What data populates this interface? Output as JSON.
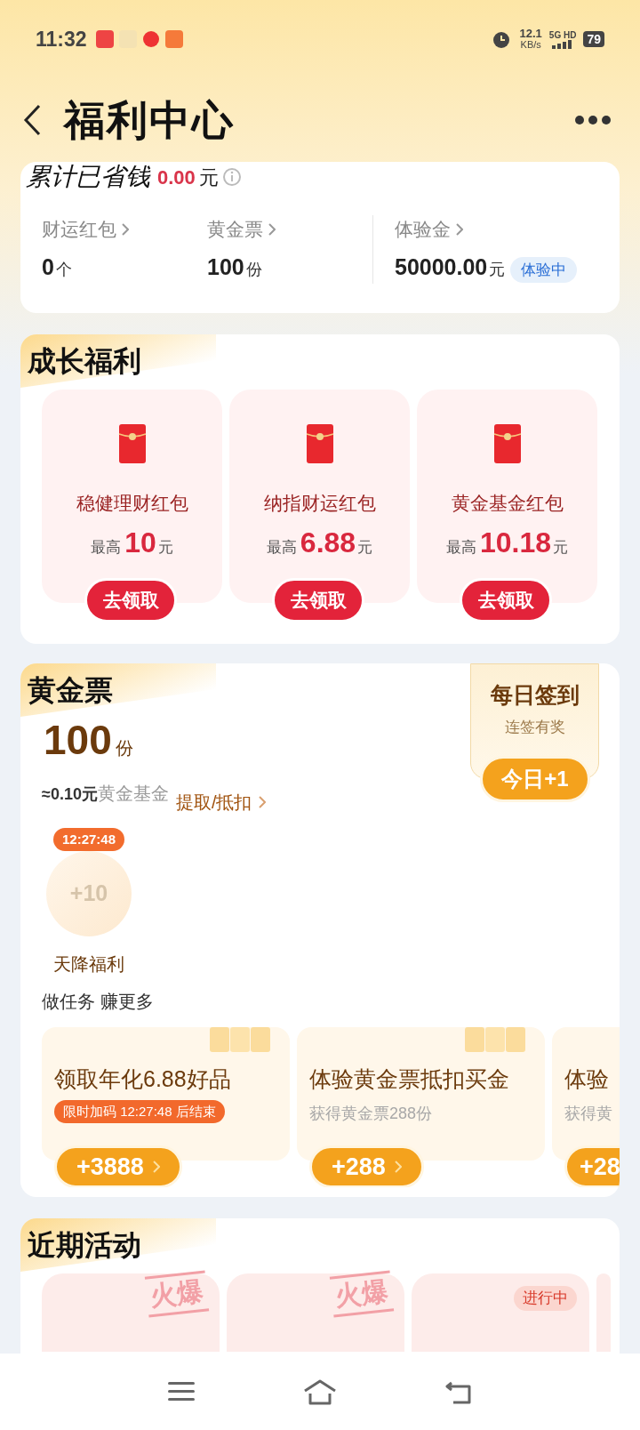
{
  "status_bar": {
    "time": "11:32",
    "speed_value": "12.1",
    "speed_unit": "KB/s",
    "network": "5G HD",
    "battery": "79"
  },
  "header": {
    "title": "福利中心"
  },
  "savings": {
    "label": "累计已省钱",
    "amount": "0.00",
    "unit": "元",
    "stats": [
      {
        "label": "财运红包",
        "value": "0",
        "unit": "个"
      },
      {
        "label": "黄金票",
        "value": "100",
        "unit": "份"
      },
      {
        "label": "体验金",
        "value": "50000.00",
        "unit": "元",
        "badge": "体验中"
      }
    ]
  },
  "growth": {
    "title": "成长福利",
    "packets": [
      {
        "name": "稳健理财红包",
        "prefix": "最高",
        "amount": "10",
        "unit": "元",
        "button": "去领取"
      },
      {
        "name": "纳指财运红包",
        "prefix": "最高",
        "amount": "6.88",
        "unit": "元",
        "button": "去领取"
      },
      {
        "name": "黄金基金红包",
        "prefix": "最高",
        "amount": "10.18",
        "unit": "元",
        "button": "去领取"
      }
    ]
  },
  "gold_ticket": {
    "title": "黄金票",
    "count": "100",
    "count_unit": "份",
    "approx": "≈0.10元",
    "approx_fund": "黄金基金",
    "link": "提取/抵扣",
    "checkin": {
      "title": "每日签到",
      "subtitle": "连签有奖",
      "button": "今日+1"
    },
    "bonus": {
      "timer": "12:27:48",
      "amount": "+10",
      "label": "天降福利"
    },
    "tasks_title": "做任务 赚更多",
    "tasks": [
      {
        "title": "领取年化6.88好品",
        "kind": "promo",
        "note": "限时加码 12:27:48 后结束",
        "button": "+3888"
      },
      {
        "title": "体验黄金票抵扣买金",
        "kind": "plain",
        "note": "获得黄金票288份",
        "button": "+288"
      },
      {
        "title": "体验",
        "kind": "plain",
        "note": "获得黄",
        "button": "+28"
      }
    ]
  },
  "activities": {
    "title": "近期活动",
    "cards": [
      {
        "kind": "stamp",
        "tag": "火爆"
      },
      {
        "kind": "stamp",
        "tag": "火爆"
      },
      {
        "kind": "badge",
        "tag": "进行中"
      },
      {
        "kind": "blank"
      }
    ]
  }
}
